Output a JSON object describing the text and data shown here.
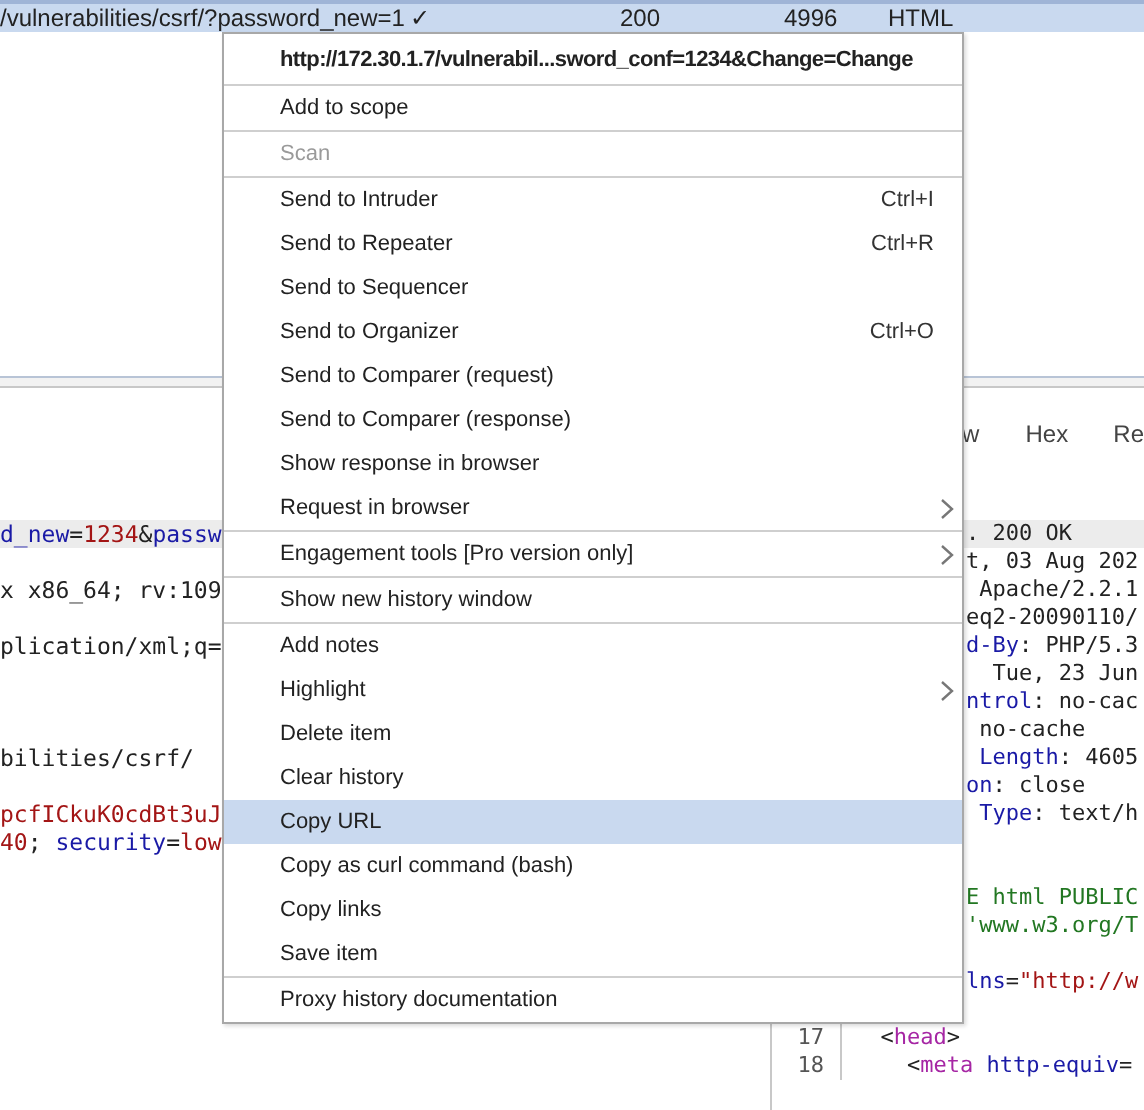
{
  "history_row": {
    "selected": true,
    "cells": [
      "/vulnerabilities/csrf/?password_new=1",
      "✓",
      "200",
      "4996",
      "HTML"
    ]
  },
  "request_lines": [
    {
      "highlighted": true,
      "tokens": [
        {
          "kind": "name",
          "text": "d_new"
        },
        {
          "kind": "punct",
          "text": "="
        },
        {
          "kind": "value",
          "text": "1234"
        },
        {
          "kind": "punct",
          "text": "&"
        },
        {
          "kind": "name",
          "text": "passw"
        }
      ]
    },
    {
      "highlighted": false
    },
    {
      "highlighted": false,
      "tokens": [
        {
          "kind": "punct",
          "text": "x x86_64; rv:109"
        }
      ]
    },
    {
      "highlighted": false
    },
    {
      "highlighted": false,
      "tokens": [
        {
          "kind": "punct",
          "text": "plication/xml;q="
        }
      ]
    },
    {
      "highlighted": false
    },
    {
      "highlighted": false
    },
    {
      "highlighted": false
    },
    {
      "highlighted": false,
      "tokens": [
        {
          "kind": "punct",
          "text": "bilities/csrf/"
        }
      ]
    },
    {
      "highlighted": false
    },
    {
      "highlighted": false,
      "tokens": [
        {
          "kind": "value",
          "text": "pcfICkuK0cdBt3uJ"
        }
      ]
    },
    {
      "highlighted": false,
      "tokens": [
        {
          "kind": "value",
          "text": "40"
        },
        {
          "kind": "punct",
          "text": "; "
        },
        {
          "kind": "name",
          "text": "security"
        },
        {
          "kind": "punct",
          "text": "="
        },
        {
          "kind": "value",
          "text": "low"
        }
      ]
    }
  ],
  "response_tabs": [
    "w",
    "Hex",
    "Re"
  ],
  "response_lines": [
    {
      "highlighted": true,
      "tokens": [
        {
          "kind": "punct",
          "text": ". 200 OK"
        }
      ]
    },
    {
      "highlighted": false,
      "tokens": [
        {
          "kind": "punct",
          "text": "t, 03 Aug 202"
        }
      ]
    },
    {
      "highlighted": false,
      "tokens": [
        {
          "kind": "punct",
          "text": " Apache/2.2.1"
        }
      ]
    },
    {
      "highlighted": false,
      "tokens": [
        {
          "kind": "punct",
          "text": "eq2-20090110/"
        }
      ]
    },
    {
      "highlighted": false,
      "tokens": [
        {
          "kind": "name",
          "text": "d-By"
        },
        {
          "kind": "punct",
          "text": ": PHP/5.3"
        }
      ]
    },
    {
      "highlighted": false,
      "tokens": [
        {
          "kind": "punct",
          "text": "  Tue, 23 Jun"
        }
      ]
    },
    {
      "highlighted": false,
      "tokens": [
        {
          "kind": "name",
          "text": "ntrol"
        },
        {
          "kind": "punct",
          "text": ": no-cac"
        }
      ]
    },
    {
      "highlighted": false,
      "tokens": [
        {
          "kind": "punct",
          "text": " no-cache"
        }
      ]
    },
    {
      "highlighted": false,
      "tokens": [
        {
          "kind": "name",
          "text": " Length"
        },
        {
          "kind": "punct",
          "text": ": 4605"
        }
      ]
    },
    {
      "highlighted": false,
      "tokens": [
        {
          "kind": "name",
          "text": "on"
        },
        {
          "kind": "punct",
          "text": ": close"
        }
      ]
    },
    {
      "highlighted": false,
      "tokens": [
        {
          "kind": "name",
          "text": " Type"
        },
        {
          "kind": "punct",
          "text": ": text/h"
        }
      ]
    },
    {
      "highlighted": false
    },
    {
      "highlighted": false
    },
    {
      "highlighted": false,
      "tokens": [
        {
          "kind": "doctype",
          "text": "E html PUBLIC"
        }
      ]
    },
    {
      "highlighted": false,
      "tokens": [
        {
          "kind": "doctype",
          "text": "'www.w3.org/T"
        }
      ]
    },
    {
      "highlighted": false
    },
    {
      "highlighted": false,
      "tokens": [
        {
          "kind": "name",
          "text": "lns"
        },
        {
          "kind": "punct",
          "text": "="
        },
        {
          "kind": "value",
          "text": "\"http://w"
        }
      ]
    },
    {
      "highlighted": false
    },
    {
      "highlighted": false,
      "number": "17",
      "tokens": [
        {
          "kind": "punct",
          "text": "  <"
        },
        {
          "kind": "tag",
          "text": "head"
        },
        {
          "kind": "punct",
          "text": ">"
        }
      ]
    },
    {
      "highlighted": false,
      "number": "18",
      "tokens": [
        {
          "kind": "punct",
          "text": "    <"
        },
        {
          "kind": "tag",
          "text": "meta"
        },
        {
          "kind": "name",
          "text": " http-equiv"
        },
        {
          "kind": "punct",
          "text": "="
        }
      ]
    }
  ],
  "context_menu": {
    "groups": [
      [
        {
          "kind": "title",
          "label": "http://172.30.1.7/vulnerabil...sword_conf=1234&Change=Change",
          "disabled": false,
          "selected": false
        }
      ],
      [
        {
          "kind": "item",
          "label": "Add to scope",
          "disabled": false,
          "selected": false
        }
      ],
      [
        {
          "kind": "item",
          "label": "Scan",
          "disabled": true,
          "selected": false
        }
      ],
      [
        {
          "kind": "item",
          "label": "Send to Intruder",
          "shortcut": "Ctrl+I",
          "disabled": false,
          "selected": false
        },
        {
          "kind": "item",
          "label": "Send to Repeater",
          "shortcut": "Ctrl+R",
          "disabled": false,
          "selected": false
        },
        {
          "kind": "item",
          "label": "Send to Sequencer",
          "disabled": false,
          "selected": false
        },
        {
          "kind": "item",
          "label": "Send to Organizer",
          "shortcut": "Ctrl+O",
          "disabled": false,
          "selected": false
        },
        {
          "kind": "item",
          "label": "Send to Comparer (request)",
          "disabled": false,
          "selected": false
        },
        {
          "kind": "item",
          "label": "Send to Comparer (response)",
          "disabled": false,
          "selected": false
        },
        {
          "kind": "item",
          "label": "Show response in browser",
          "disabled": false,
          "selected": false
        },
        {
          "kind": "submenu",
          "label": "Request in browser",
          "disabled": false,
          "selected": false
        }
      ],
      [
        {
          "kind": "submenu",
          "label": "Engagement tools [Pro version only]",
          "disabled": false,
          "selected": false
        }
      ],
      [
        {
          "kind": "item",
          "label": "Show new history window",
          "disabled": false,
          "selected": false
        }
      ],
      [
        {
          "kind": "item",
          "label": "Add notes",
          "disabled": false,
          "selected": false
        },
        {
          "kind": "submenu",
          "label": "Highlight",
          "disabled": false,
          "selected": false
        },
        {
          "kind": "item",
          "label": "Delete item",
          "disabled": false,
          "selected": false
        },
        {
          "kind": "item",
          "label": "Clear history",
          "disabled": false,
          "selected": false
        },
        {
          "kind": "item",
          "label": "Copy URL",
          "disabled": false,
          "selected": true
        },
        {
          "kind": "item",
          "label": "Copy as curl command (bash)",
          "disabled": false,
          "selected": false
        },
        {
          "kind": "item",
          "label": "Copy links",
          "disabled": false,
          "selected": false
        },
        {
          "kind": "item",
          "label": "Save item",
          "disabled": false,
          "selected": false
        }
      ],
      [
        {
          "kind": "item",
          "label": "Proxy history documentation",
          "disabled": false,
          "selected": false
        }
      ]
    ]
  }
}
